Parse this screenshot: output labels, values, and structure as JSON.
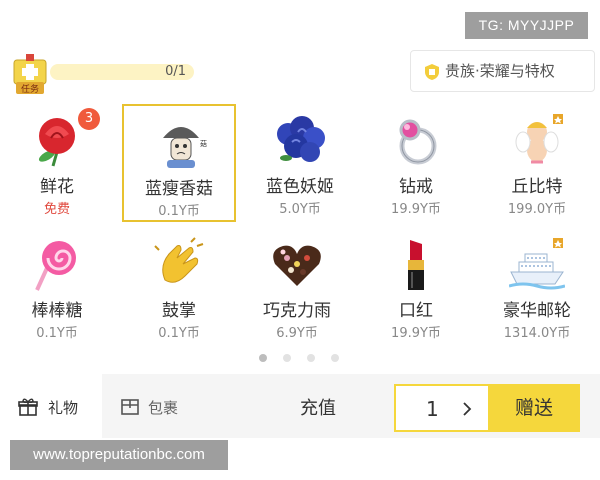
{
  "watermark_top": "TG: MYYJJPP",
  "watermark_bottom": "www.topreputationbc.com",
  "task": {
    "label": "任务",
    "progress": "0/1",
    "progress_fraction": 0
  },
  "noble_button": {
    "label": "贵族·荣耀与特权"
  },
  "gifts": [
    {
      "name": "鲜花",
      "price": "免费",
      "badge": "3",
      "icon": "rose-icon"
    },
    {
      "name": "蓝瘦香菇",
      "price": "0.1Y币",
      "icon": "blue-mushroom-icon",
      "selected": true
    },
    {
      "name": "蓝色妖姬",
      "price": "5.0Y币",
      "icon": "blue-roses-icon"
    },
    {
      "name": "钻戒",
      "price": "19.9Y币",
      "icon": "diamond-ring-icon"
    },
    {
      "name": "丘比特",
      "price": "199.0Y币",
      "icon": "cupid-icon"
    },
    {
      "name": "棒棒糖",
      "price": "0.1Y币",
      "icon": "lollipop-icon"
    },
    {
      "name": "鼓掌",
      "price": "0.1Y币",
      "icon": "clapping-hands-icon"
    },
    {
      "name": "巧克力雨",
      "price": "6.9Y币",
      "icon": "chocolate-heart-icon"
    },
    {
      "name": "口红",
      "price": "19.9Y币",
      "icon": "lipstick-icon"
    },
    {
      "name": "豪华邮轮",
      "price": "1314.0Y币",
      "icon": "cruise-ship-icon"
    }
  ],
  "pagination": {
    "pages": 4,
    "current": 1
  },
  "tabs": [
    {
      "label": "礼物",
      "icon": "gift-box-icon",
      "active": true
    },
    {
      "label": "包裹",
      "icon": "package-icon",
      "active": false
    }
  ],
  "charge_label": "充值",
  "quantity": "1",
  "send_label": "赠送",
  "colors": {
    "accent": "#f5d73c",
    "badge": "#f05a3c",
    "free": "#e0483d"
  }
}
